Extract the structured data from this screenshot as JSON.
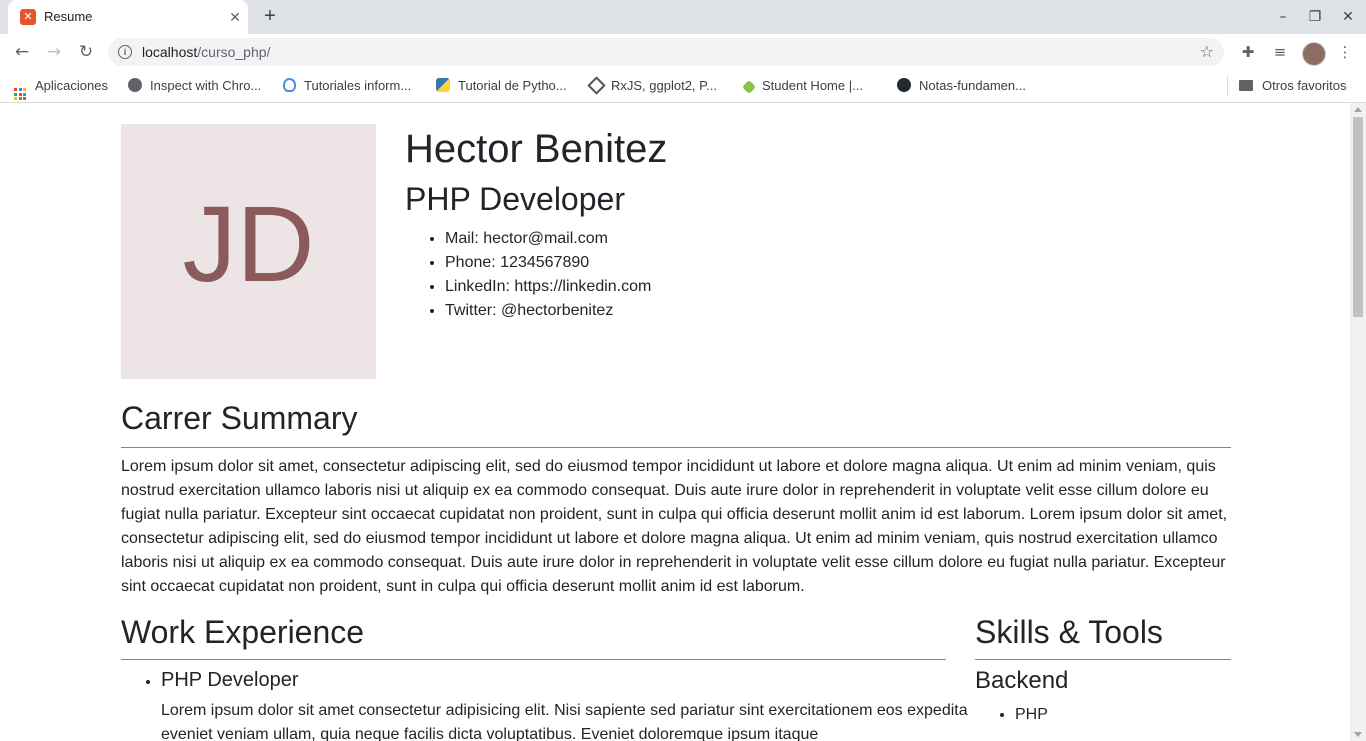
{
  "browser": {
    "tab_title": "Resume",
    "tab_favicon": "xampp-icon",
    "new_tab": "+",
    "url_host": "localhost",
    "url_path": "/curso_php/",
    "bookmarks": [
      {
        "label": "Aplicaciones",
        "icon": "apps-grid-icon"
      },
      {
        "label": "Inspect with Chro...",
        "icon": "globe-icon"
      },
      {
        "label": "Tutoriales inform...",
        "icon": "bulb-icon"
      },
      {
        "label": "Tutorial de Pytho...",
        "icon": "python-icon"
      },
      {
        "label": "RxJS, ggplot2, P...",
        "icon": "diamond-icon"
      },
      {
        "label": "Student Home |...",
        "icon": "student-icon"
      },
      {
        "label": "Notas-fundamen...",
        "icon": "github-icon"
      }
    ],
    "other_bookmarks": "Otros favoritos"
  },
  "resume": {
    "photo_initials": "JD",
    "name": "Hector Benitez",
    "title": "PHP Developer",
    "contacts": [
      "Mail: hector@mail.com",
      "Phone: 1234567890",
      "LinkedIn: https://linkedin.com",
      "Twitter: @hectorbenitez"
    ],
    "summary_heading": "Carrer Summary",
    "summary_text": "Lorem ipsum dolor sit amet, consectetur adipiscing elit, sed do eiusmod tempor incididunt ut labore et dolore magna aliqua. Ut enim ad minim veniam, quis nostrud exercitation ullamco laboris nisi ut aliquip ex ea commodo consequat. Duis aute irure dolor in reprehenderit in voluptate velit esse cillum dolore eu fugiat nulla pariatur. Excepteur sint occaecat cupidatat non proident, sunt in culpa qui officia deserunt mollit anim id est laborum. Lorem ipsum dolor sit amet, consectetur adipiscing elit, sed do eiusmod tempor incididunt ut labore et dolore magna aliqua. Ut enim ad minim veniam, quis nostrud exercitation ullamco laboris nisi ut aliquip ex ea commodo consequat. Duis aute irure dolor in reprehenderit in voluptate velit esse cillum dolore eu fugiat nulla pariatur. Excepteur sint occaecat cupidatat non proident, sunt in culpa qui officia deserunt mollit anim id est laborum.",
    "work_heading": "Work Experience",
    "jobs": [
      {
        "title": "PHP Developer",
        "description": "Lorem ipsum dolor sit amet consectetur adipisicing elit. Nisi sapiente sed pariatur sint exercitationem eos expedita eveniet veniam ullam, quia neque facilis dicta voluptatibus. Eveniet doloremque ipsum itaque"
      }
    ],
    "skills_heading": "Skills & Tools",
    "skills_group": "Backend",
    "skills": [
      "PHP"
    ]
  }
}
